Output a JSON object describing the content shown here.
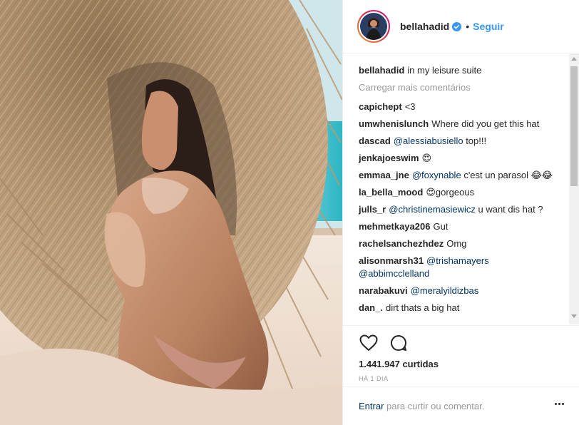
{
  "post": {
    "username": "bellahadid",
    "follow_label": "Seguir",
    "separator": "•",
    "caption_user": "bellahadid",
    "caption_text": "in my leisure suite",
    "load_more_label": "Carregar mais comentários",
    "likes_text": "1.441.947 curtidas",
    "time_text": "HÁ 1 DIA"
  },
  "comments": [
    {
      "user": "capichept",
      "text": "<3",
      "mention": ""
    },
    {
      "user": "umwhenislunch",
      "text": "Where did you get this hat",
      "mention": ""
    },
    {
      "user": "dascad",
      "mention": "@alessiabusiello",
      "text": "top!!!"
    },
    {
      "user": "jenkajoeswim",
      "text": "😍",
      "mention": ""
    },
    {
      "user": "emmaa_jne",
      "mention": "@foxynable",
      "text": "c'est un parasol 😂😂"
    },
    {
      "user": "la_bella_mood",
      "text": "😍gorgeous",
      "mention": ""
    },
    {
      "user": "julls_r",
      "mention": "@christinemasiewicz",
      "text": "u want dis hat ?"
    },
    {
      "user": "mehmetkaya206",
      "text": "Gut",
      "mention": ""
    },
    {
      "user": "rachelsanchezhdez",
      "text": "Omg",
      "mention": ""
    },
    {
      "user": "alisonmarsh31",
      "mention": "@trishamayers @abbimcclelland",
      "text": ""
    },
    {
      "user": "narabakuvi",
      "mention": "@meralyildizbas",
      "text": ""
    },
    {
      "user": "dan_.",
      "text": "dirt thats a big hat",
      "mention": ""
    }
  ],
  "footer": {
    "enter_label": "Entrar",
    "rest_label": "para curtir ou comentar."
  },
  "icons": {
    "like": "heart-icon",
    "comment": "comment-icon",
    "verified": "verified-badge-icon",
    "more": "more-options-icon"
  },
  "colors": {
    "link_blue": "#3897f0",
    "mention_blue": "#003569",
    "muted_gray": "#999999",
    "text": "#262626"
  }
}
